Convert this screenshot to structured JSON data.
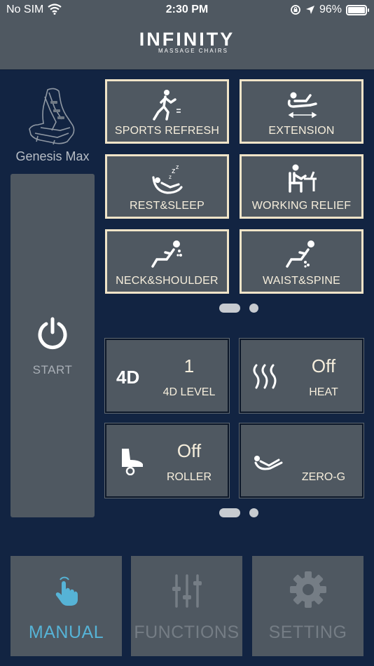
{
  "status_bar": {
    "carrier": "No SIM",
    "time": "2:30 PM",
    "battery": "96%"
  },
  "header": {
    "brand": "INFINITY",
    "tagline": "MASSAGE CHAIRS"
  },
  "chair": {
    "model": "Genesis Max"
  },
  "start": {
    "label": "START"
  },
  "programs": [
    {
      "label": "SPORTS REFRESH",
      "icon": "sports-icon"
    },
    {
      "label": "EXTENSION",
      "icon": "stretch-icon"
    },
    {
      "label": "REST&SLEEP",
      "icon": "sleep-icon"
    },
    {
      "label": "WORKING RELIEF",
      "icon": "desk-icon"
    },
    {
      "label": "NECK&SHOULDER",
      "icon": "neck-icon"
    },
    {
      "label": "WAIST&SPINE",
      "icon": "waist-icon"
    }
  ],
  "settings": {
    "fourd": {
      "icon_text": "4D",
      "value": "1",
      "label": "4D LEVEL"
    },
    "heat": {
      "value": "Off",
      "label": "HEAT"
    },
    "roller": {
      "value": "Off",
      "label": "ROLLER"
    },
    "zerog": {
      "label": "ZERO-G"
    }
  },
  "nav": {
    "manual": "MANUAL",
    "functions": "FUNCTIONS",
    "setting": "SETTING",
    "active": "manual"
  },
  "colors": {
    "background": "#122442",
    "panel": "#4f5861",
    "tile_border": "#f0e4c8",
    "text_cream": "#f6eedc",
    "accent": "#56b3d6"
  }
}
